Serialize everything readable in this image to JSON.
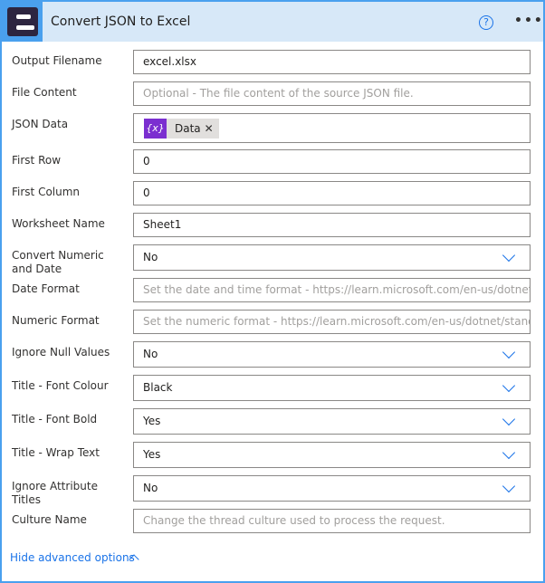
{
  "header": {
    "title": "Convert JSON to Excel",
    "help_icon": "question-circle-icon",
    "more_icon": "ellipsis-icon"
  },
  "fields": [
    {
      "label": "Output Filename",
      "type": "text",
      "value": "excel.xlsx",
      "placeholder": ""
    },
    {
      "label": "File Content",
      "type": "text",
      "value": "",
      "placeholder": "Optional - The file content of the source JSON file."
    },
    {
      "label": "JSON Data",
      "type": "token",
      "value": "Data",
      "token_icon": "{x}"
    },
    {
      "label": "First Row",
      "type": "text",
      "value": "0",
      "placeholder": ""
    },
    {
      "label": "First Column",
      "type": "text",
      "value": "0",
      "placeholder": ""
    },
    {
      "label": "Worksheet Name",
      "type": "text",
      "value": "Sheet1",
      "placeholder": ""
    },
    {
      "label": "Convert Numeric and Date",
      "type": "select",
      "value": "No"
    },
    {
      "label": "Date Format",
      "type": "text",
      "value": "",
      "placeholder": "Set the date and time format - https://learn.microsoft.com/en-us/dotnet/standard/base-types/custom-date-and-time-format-strings"
    },
    {
      "label": "Numeric Format",
      "type": "text",
      "value": "",
      "placeholder": "Set the numeric format - https://learn.microsoft.com/en-us/dotnet/standard/base-types/custom-numeric-format-strings"
    },
    {
      "label": "Ignore Null Values",
      "type": "select",
      "value": "No"
    },
    {
      "label": "Title - Font Colour",
      "type": "select",
      "value": "Black"
    },
    {
      "label": "Title - Font Bold",
      "type": "select",
      "value": "Yes"
    },
    {
      "label": "Title - Wrap Text",
      "type": "select",
      "value": "Yes"
    },
    {
      "label": "Ignore Attribute Titles",
      "type": "select",
      "value": "No"
    },
    {
      "label": "Culture Name",
      "type": "text",
      "value": "",
      "placeholder": "Change the thread culture used to process the request."
    }
  ],
  "footer": {
    "advanced_label": "Hide advanced options"
  },
  "colors": {
    "accent": "#1a73e8",
    "border": "#4aa0ee",
    "header_bg": "#d7e8f8",
    "token": "#7b2fd0"
  }
}
